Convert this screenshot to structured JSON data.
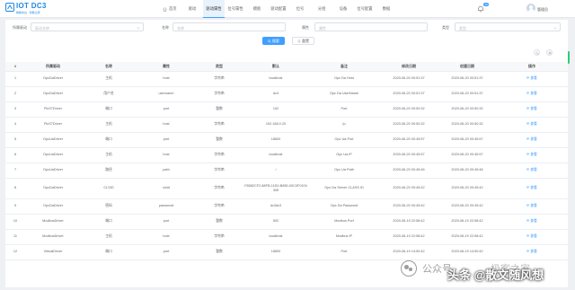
{
  "app": {
    "title": "IOT DC3",
    "subtitle": "物联中台 · 智能之家",
    "brand_color": "#1e88e5",
    "accent_color": "#409eff"
  },
  "nav": {
    "items": [
      {
        "label": "首页",
        "icon": "home-icon"
      },
      {
        "label": "驱动"
      },
      {
        "label": "驱动属性",
        "active": true
      },
      {
        "label": "位号属性"
      },
      {
        "label": "模板"
      },
      {
        "label": "驱动配置"
      },
      {
        "label": "位号"
      },
      {
        "label": "分组"
      },
      {
        "label": "设备"
      },
      {
        "label": "位号配置"
      },
      {
        "label": "数据"
      }
    ]
  },
  "header": {
    "notification_count": "10",
    "user_name": "管理员"
  },
  "filters": {
    "driver_label": "所属驱动",
    "driver_placeholder": "驱动名称",
    "name_label": "名称",
    "name_placeholder": "名称",
    "attr_label": "属性",
    "attr_placeholder": "属性",
    "type_label": "类型",
    "type_placeholder": "类型"
  },
  "actions": {
    "search_label": "搜索",
    "reset_label": "重置"
  },
  "table": {
    "columns": [
      "#",
      "所属驱动",
      "名称",
      "属性",
      "类型",
      "默认",
      "备注",
      "修改日期",
      "创建日期",
      "操作"
    ],
    "rows": [
      {
        "no": "1",
        "driver": "OpcDaDriver",
        "name": "主机",
        "attr": "host",
        "type": "字符串",
        "default": "localhost",
        "remark": "Opc Da Host",
        "updated": "2020-06-20 00:51:37",
        "created": "2020-06-20 00:51:37",
        "op": "查看"
      },
      {
        "no": "2",
        "driver": "OpcDaDriver",
        "name": "用户名",
        "attr": "username",
        "type": "字符串",
        "default": "dc3",
        "remark": "Opc Da UserName",
        "updated": "2020-06-20 00:51:37",
        "created": "2020-06-20 00:51:37",
        "op": "查看"
      },
      {
        "no": "3",
        "driver": "PlcS7Driver",
        "name": "端口",
        "attr": "port",
        "type": "整数",
        "default": "102",
        "remark": "Port",
        "updated": "2020-06-20 00:50:32",
        "created": "2020-06-20 00:50:32",
        "op": "查看"
      },
      {
        "no": "4",
        "driver": "PlcS7Driver",
        "name": "主机",
        "attr": "host",
        "type": "字符串",
        "default": "192.168.0.20",
        "remark": "Ip",
        "updated": "2020-06-20 00:50:32",
        "created": "2020-06-20 00:50:32",
        "op": "查看"
      },
      {
        "no": "5",
        "driver": "OpcUaDriver",
        "name": "端口",
        "attr": "port",
        "type": "整数",
        "default": "18600",
        "remark": "Opc Ua Port",
        "updated": "2020-06-20 00:45:57",
        "created": "2020-06-20 00:45:57",
        "op": "查看"
      },
      {
        "no": "6",
        "driver": "OpcUaDriver",
        "name": "主机",
        "attr": "host",
        "type": "字符串",
        "default": "localhost",
        "remark": "Opc Ua IP",
        "updated": "2020-06-20 00:45:57",
        "created": "2020-06-20 00:45:57",
        "op": "查看"
      },
      {
        "no": "7",
        "driver": "OpcUaDriver",
        "name": "路径",
        "attr": "path",
        "type": "字符串",
        "default": "/",
        "remark": "Opc Ua Path",
        "updated": "2020-06-20 00:45:46",
        "created": "2020-06-20 00:45:46",
        "op": "查看"
      },
      {
        "no": "8",
        "driver": "OpcDaDriver",
        "name": "CLSID",
        "attr": "clsId",
        "type": "字符串",
        "default": "F8582CF2-88FB-11D0-B850-00C0F0104305",
        "remark": "Opc Da Server CLASS ID",
        "updated": "2020-06-20 00:45:42",
        "created": "2020-06-20 00:45:42",
        "op": "查看",
        "tall": true
      },
      {
        "no": "9",
        "driver": "OpcDaDriver",
        "name": "密码",
        "attr": "password",
        "type": "字符串",
        "default": "dc3dc3",
        "remark": "Opc Da Password",
        "updated": "2020-06-20 00:45:42",
        "created": "2020-06-20 00:45:42",
        "op": "查看"
      },
      {
        "no": "10",
        "driver": "ModbusDriver",
        "name": "端口",
        "attr": "port",
        "type": "整数",
        "default": "502",
        "remark": "Modbus Port",
        "updated": "2020-06-19 22:58:42",
        "created": "2020-06-19 22:58:42",
        "op": "查看"
      },
      {
        "no": "11",
        "driver": "ModbusDriver",
        "name": "主机",
        "attr": "host",
        "type": "字符串",
        "default": "localhost",
        "remark": "Modbus IP",
        "updated": "2020-06-19 22:58:42",
        "created": "2020-06-19 22:58:42",
        "op": "查看"
      },
      {
        "no": "12",
        "driver": "VirtualDriver",
        "name": "端口",
        "attr": "port",
        "type": "整数",
        "default": "18600",
        "remark": "Port",
        "updated": "2020-06-19 14:50:42",
        "created": "2020-06-19 14:50:42",
        "op": "查看"
      }
    ]
  },
  "watermark": {
    "left_text": "公众号 ·",
    "right_text": "极客之家",
    "author": "头条 @散文随风想"
  }
}
